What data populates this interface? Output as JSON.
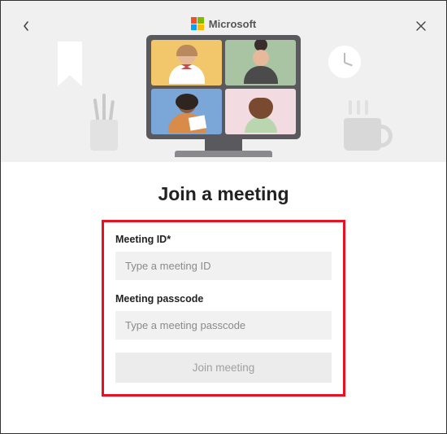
{
  "brand": {
    "name": "Microsoft"
  },
  "title": "Join a meeting",
  "form": {
    "meeting_id": {
      "label": "Meeting ID*",
      "placeholder": "Type a meeting ID",
      "value": ""
    },
    "passcode": {
      "label": "Meeting passcode",
      "placeholder": "Type a meeting passcode",
      "value": ""
    },
    "submit_label": "Join meeting"
  }
}
